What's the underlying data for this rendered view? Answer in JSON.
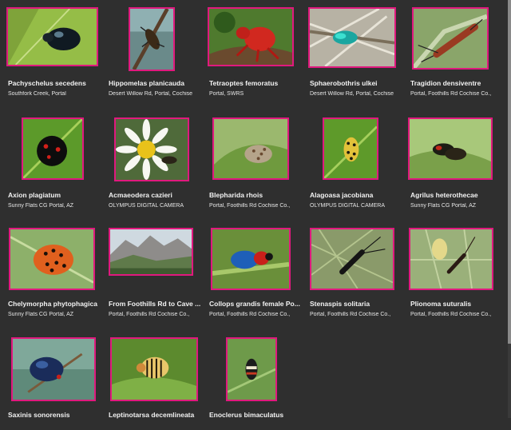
{
  "gallery": {
    "items": [
      {
        "title": "Pachyschelus secedens",
        "subtitle": "Southfork Creek, Portal",
        "scene": "dark-beetle-leaf"
      },
      {
        "title": "Hippomelas planicauda",
        "subtitle": "Desert Willow Rd, Portal, Cochise",
        "scene": "beetle-branch"
      },
      {
        "title": "Tetraoptes femoratus",
        "subtitle": "Portal, SWRS",
        "scene": "red-beetle"
      },
      {
        "title": "Sphaerobothris ulkei",
        "subtitle": "Desert Willow Rd, Portal, Cochise",
        "scene": "green-beetle-twig"
      },
      {
        "title": "Tragidion densiventre",
        "subtitle": "Portal, Foothills Rd  Cochise Co.,",
        "scene": "long-beetle"
      },
      {
        "title": "Axion plagiatum",
        "subtitle": "Sunny Flats CG Portal, AZ",
        "scene": "black-ladybug"
      },
      {
        "title": "Acmaeodera cazieri",
        "subtitle": "OLYMPUS DIGITAL CAMERA",
        "scene": "daisy"
      },
      {
        "title": "Blepharida rhois",
        "subtitle": "Portal, Foothills Rd  Cochise Co.,",
        "scene": "spotted-beetle-leaf"
      },
      {
        "title": "Alagoasa jacobiana",
        "subtitle": "OLYMPUS DIGITAL CAMERA",
        "scene": "yellow-spotted"
      },
      {
        "title": "Agrilus heterothecae",
        "subtitle": "Sunny Flats CG Portal, AZ",
        "scene": "pair-beetles"
      },
      {
        "title": "Chelymorpha phytophagica",
        "subtitle": "Sunny Flats CG Portal, AZ",
        "scene": "orange-ladybug"
      },
      {
        "title": "From Foothills Rd to Cave ...",
        "subtitle": "Portal, Foothills Rd  Cochise Co.,",
        "scene": "mountains"
      },
      {
        "title": "Collops  grandis female Po...",
        "subtitle": "Portal, Foothills Rd  Cochise Co.,",
        "scene": "blue-red-beetle"
      },
      {
        "title": "Stenaspis solitaria",
        "subtitle": "Portal, Foothills Rd  Cochise Co.,",
        "scene": "longhorn-twig"
      },
      {
        "title": "Plionoma suturalis",
        "subtitle": "Portal, Foothills Rd  Cochise Co.,",
        "scene": "longhorn-flower"
      },
      {
        "title": "Saxinis sonorensis",
        "subtitle": "",
        "scene": "blue-beetle-stem"
      },
      {
        "title": "Leptinotarsa decemlineata",
        "subtitle": "",
        "scene": "potato-beetle"
      },
      {
        "title": "Enoclerus bimaculatus",
        "subtitle": "",
        "scene": "checkered-beetle"
      }
    ]
  },
  "colors": {
    "background": "#2f2f2f",
    "frame": "#e0197e"
  }
}
